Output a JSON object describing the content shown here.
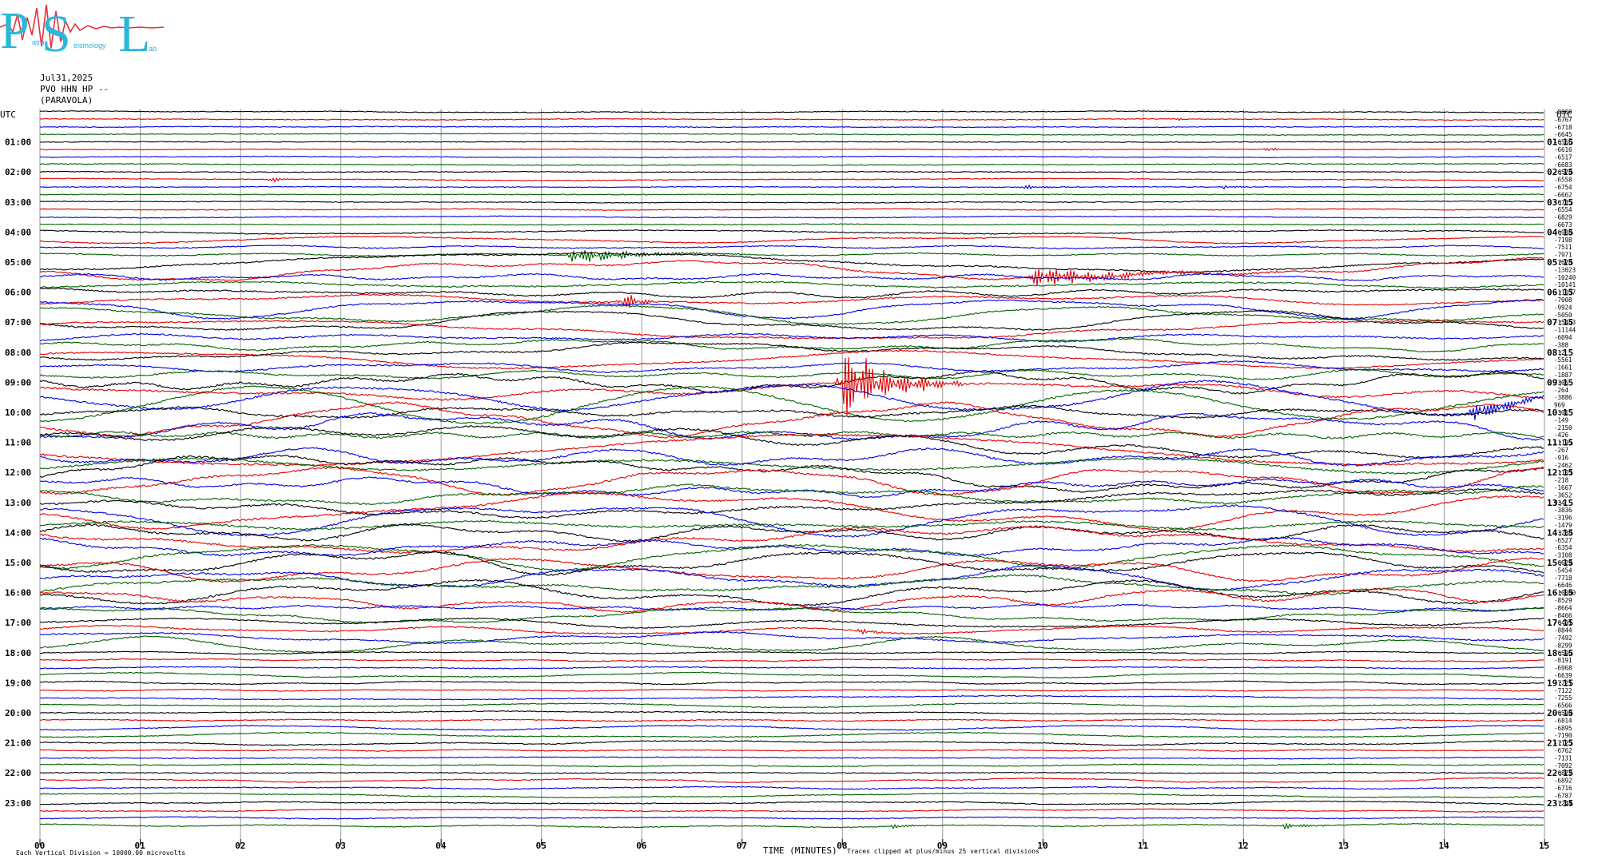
{
  "header": {
    "date": "Jul31,2025",
    "station": "PVO HHN HP --",
    "location": "(PARAVOLA)"
  },
  "logo": {
    "letters": [
      "P",
      "S",
      "L"
    ],
    "sublabels": [
      "atras",
      "eismology",
      "ab"
    ],
    "colors": [
      "#2bb7d8",
      "#e8303a"
    ]
  },
  "footer": {
    "left_note": "Each Vertical Division = 10000.00 microvolts",
    "xlabel": "TIME (MINUTES)",
    "clip_note": "Traces clipped at plus/minus 25 vertical divisions"
  },
  "chart_data": {
    "type": "line",
    "title": "",
    "xlabel": "TIME (MINUTES)",
    "ylabel": "",
    "xlim": [
      0,
      15
    ],
    "x_ticks": [
      "00",
      "01",
      "02",
      "03",
      "04",
      "05",
      "06",
      "07",
      "08",
      "09",
      "10",
      "11",
      "12",
      "13",
      "14",
      "15"
    ],
    "left_axis_title": "UTC",
    "right_axis_title": "UTC",
    "left_labels": [
      "01:00",
      "02:00",
      "03:00",
      "04:00",
      "05:00",
      "06:00",
      "07:00",
      "08:00",
      "09:00",
      "10:00",
      "11:00",
      "12:00",
      "13:00",
      "14:00",
      "15:00",
      "16:00",
      "17:00",
      "18:00",
      "19:00",
      "20:00",
      "21:00",
      "22:00",
      "23:00"
    ],
    "right_labels": [
      "01:15",
      "02:15",
      "03:15",
      "04:15",
      "05:15",
      "06:15",
      "07:15",
      "08:15",
      "09:15",
      "10:15",
      "11:15",
      "12:15",
      "13:15",
      "14:15",
      "15:15",
      "16:15",
      "17:15",
      "18:15",
      "19:15",
      "20:15",
      "21:15",
      "22:15",
      "23:15"
    ],
    "trace_colors": [
      "#000000",
      "#e00000",
      "#0000e0",
      "#006000"
    ],
    "trace_count": 96,
    "trace_offsets": [
      "-8009",
      "-6767",
      "-6718",
      "-6645",
      "-6566",
      "-6616",
      "-6517",
      "-6683",
      "-6570",
      "-6558",
      "-6754",
      "-6662",
      "-6735",
      "-6554",
      "-6829",
      "-6673",
      "-6988",
      "-7198",
      "-7511",
      "-7971",
      "-7678",
      "-13023",
      "-10240",
      "-10141",
      "-11037",
      "-7008",
      "-9924",
      "-5050",
      "-15463",
      "-11144",
      "-6094",
      "-388",
      "-12",
      "-5561",
      "-1661",
      "-1887",
      "7306",
      "-264",
      "-3886",
      "969",
      "-301",
      "-149",
      "-2150",
      "-426",
      "-1195",
      "-267",
      "-916",
      "-2462",
      "-1103",
      "-218",
      "-1667",
      "-3652",
      "934",
      "-3836",
      "-3196",
      "-1479",
      "-3288",
      "-6527",
      "-6354",
      "-3108",
      "-6629",
      "-5454",
      "-7718",
      "-6646",
      "-10080",
      "-8529",
      "-8664",
      "-8466",
      "-6491",
      "-8844",
      "-7492",
      "-8299",
      "-6596",
      "-8191",
      "-6968",
      "-6639",
      "-7221",
      "-7122",
      "-7255",
      "-6566",
      "-6590",
      "-6814",
      "-6895",
      "-7190",
      "-7125",
      "-6762",
      "-7131",
      "-7092",
      "-6872",
      "-6892",
      "-6716",
      "-6787",
      "-7244"
    ],
    "events": [
      {
        "trace": 1,
        "minute": 11.35,
        "amp": 3,
        "dur": 0.1
      },
      {
        "trace": 5,
        "minute": 12.25,
        "amp": 10,
        "dur": 0.12
      },
      {
        "trace": 9,
        "minute": 2.3,
        "amp": 4,
        "dur": 0.3
      },
      {
        "trace": 10,
        "minute": 9.8,
        "amp": 3,
        "dur": 0.8
      },
      {
        "trace": 10,
        "minute": 11.8,
        "amp": 3,
        "dur": 0.5
      },
      {
        "trace": 19,
        "minute": 5.3,
        "amp": 12,
        "dur": 1.8
      },
      {
        "trace": 21,
        "minute": 9.9,
        "amp": 14,
        "dur": 2.5
      },
      {
        "trace": 25,
        "minute": 5.8,
        "amp": 18,
        "dur": 0.35
      },
      {
        "trace": 37,
        "minute": 8.0,
        "amp": 60,
        "dur": 1.2
      },
      {
        "trace": 38,
        "minute": 14.3,
        "amp": 20,
        "dur": 0.9
      },
      {
        "trace": 69,
        "minute": 8.2,
        "amp": 6,
        "dur": 0.3
      },
      {
        "trace": 95,
        "minute": 8.5,
        "amp": 4,
        "dur": 0.5
      },
      {
        "trace": 95,
        "minute": 12.4,
        "amp": 5,
        "dur": 0.8
      }
    ]
  }
}
